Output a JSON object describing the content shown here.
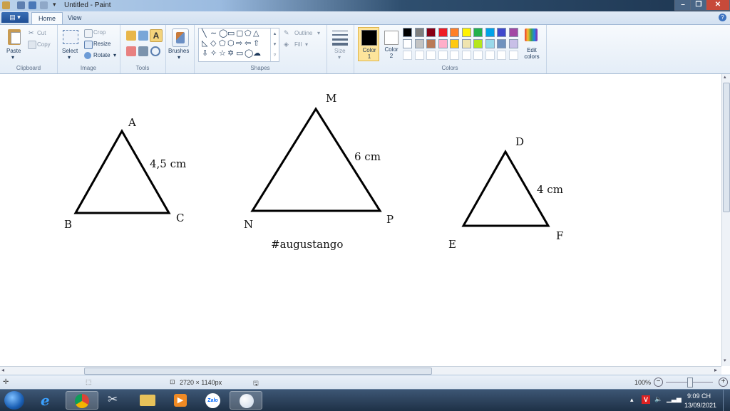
{
  "window": {
    "title": "Untitled - Paint"
  },
  "tabs": [
    {
      "label": "Home"
    },
    {
      "label": "View"
    }
  ],
  "ribbon": {
    "clipboard": {
      "group": "Clipboard",
      "paste": "Paste",
      "cut": "Cut",
      "copy": "Copy"
    },
    "image": {
      "group": "Image",
      "select": "Select",
      "crop": "Crop",
      "resize": "Resize",
      "rotate": "Rotate"
    },
    "tools": {
      "group": "Tools"
    },
    "brushes": {
      "label": "Brushes"
    },
    "shapes": {
      "group": "Shapes",
      "outline": "Outline",
      "fill": "Fill"
    },
    "size": {
      "label": "Size"
    },
    "colors": {
      "group": "Colors",
      "color1": "Color 1",
      "color2": "Color 2",
      "edit": "Edit colors",
      "row1": [
        "#000000",
        "#7f7f7f",
        "#880015",
        "#ed1c24",
        "#ff7f27",
        "#fff200",
        "#22b14c",
        "#00a2e8",
        "#3f48cc",
        "#a349a4"
      ],
      "row2": [
        "#ffffff",
        "#c3c3c3",
        "#b97a57",
        "#ffaec9",
        "#ffc90e",
        "#efe4b0",
        "#b5e61d",
        "#99d9ea",
        "#7092be",
        "#c8bfe7"
      ],
      "color1_value": "#000000",
      "color2_value": "#ffffff"
    }
  },
  "canvas": {
    "triangles": [
      {
        "top": "A",
        "left": "B",
        "right": "C",
        "side": "4,5 cm"
      },
      {
        "top": "M",
        "left": "N",
        "right": "P",
        "side": "6 cm"
      },
      {
        "top": "D",
        "left": "E",
        "right": "F",
        "side": "4 cm"
      }
    ],
    "caption": "#augustango"
  },
  "status": {
    "dimensions": "2720 × 1140px",
    "zoom": "100%"
  },
  "taskbar": {
    "time": "9:09 CH",
    "date": "13/09/2021",
    "zalo": "Zalo"
  }
}
